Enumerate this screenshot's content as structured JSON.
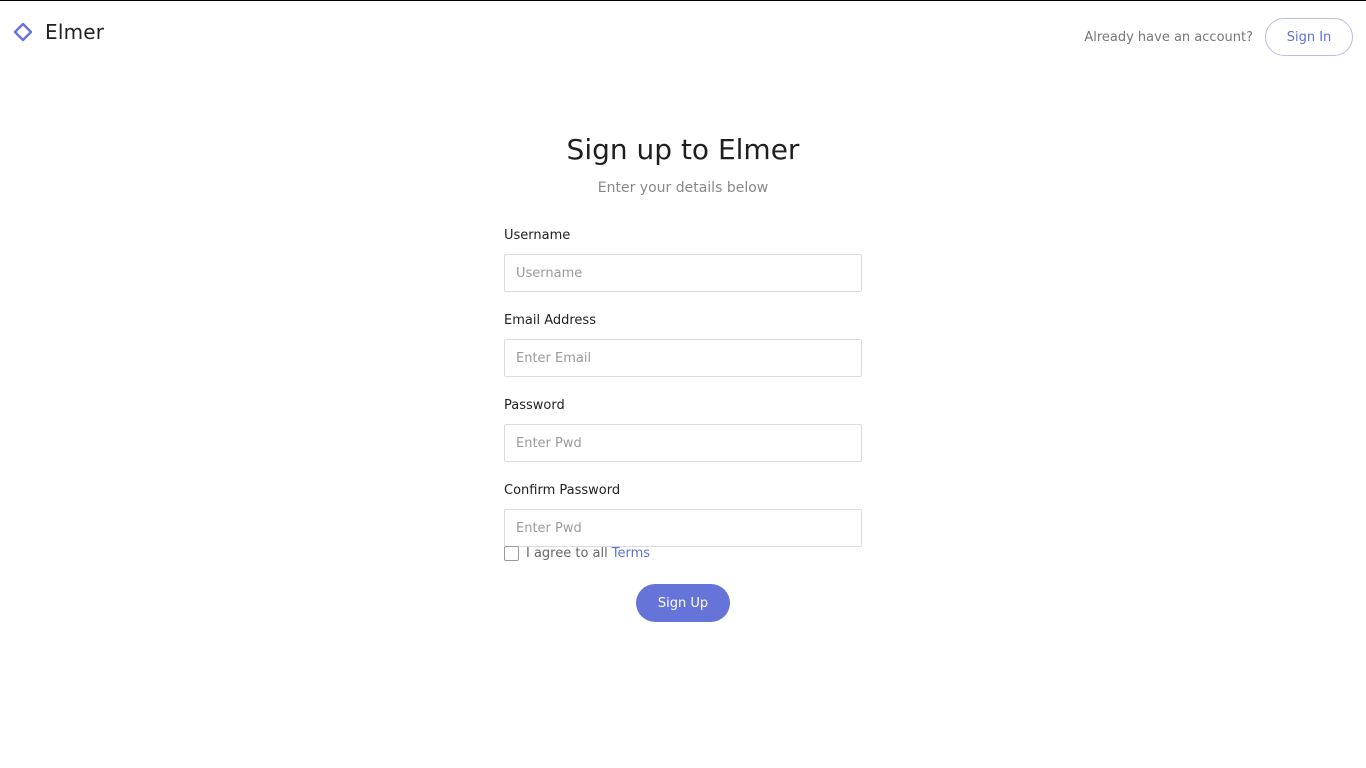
{
  "header": {
    "brand_name": "Elmer",
    "brand_icon": "diamond-logo-icon",
    "account_prompt": "Already have an account?",
    "signin_label": "Sign In"
  },
  "main": {
    "title": "Sign up to Elmer",
    "subtitle": "Enter your details below",
    "fields": [
      {
        "label": "Username",
        "placeholder": "Username",
        "value": ""
      },
      {
        "label": "Email Address",
        "placeholder": "Enter Email",
        "value": ""
      },
      {
        "label": "Password",
        "placeholder": "Enter Pwd",
        "value": ""
      },
      {
        "label": "Confirm Password",
        "placeholder": "Enter Pwd",
        "value": ""
      }
    ],
    "terms": {
      "checked": false,
      "text": "I agree to all",
      "link_text": "Terms"
    },
    "signup_label": "Sign Up"
  },
  "colors": {
    "accent": "#6674da",
    "link": "#5f6fd6",
    "muted_text": "#888888"
  }
}
